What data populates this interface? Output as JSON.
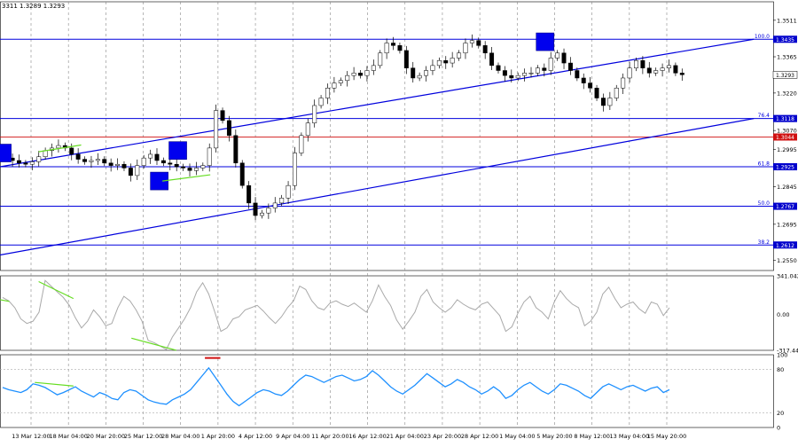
{
  "header": {
    "ohlc_text": "3311 1.3289 1.3293"
  },
  "chart_data": [
    {
      "type": "candlestick",
      "title": "",
      "ylim": [
        1.251,
        1.3585
      ],
      "price_ticks": [
        1.3511,
        1.3365,
        1.322,
        1.307,
        1.2995,
        1.2845,
        1.2695,
        1.255
      ],
      "current_price": "1.3293",
      "fib_levels": [
        {
          "label": "100.0",
          "value": 1.3435,
          "value_text": "1.3435",
          "color": "#0000dd"
        },
        {
          "label": "76.4",
          "value": 1.3118,
          "value_text": "1.3118",
          "color": "#0000dd"
        },
        {
          "label": "61.8",
          "value": 1.2925,
          "value_text": "1.2925",
          "color": "#0000dd"
        },
        {
          "label": "50.0",
          "value": 1.2767,
          "value_text": "1.2767",
          "color": "#0000dd"
        },
        {
          "label": "38.2",
          "value": 1.2612,
          "value_text": "1.2612",
          "color": "#0000dd"
        }
      ],
      "red_level": {
        "value": 1.3044,
        "value_text": "1.3044",
        "color": "#d01010"
      },
      "x_labels": [
        "13 Mar 12:00",
        "18 Mar 04:00",
        "20 Mar 20:00",
        "25 Mar 12:00",
        "28 Mar 04:00",
        "1 Apr 20:00",
        "4 Apr 12:00",
        "9 Apr 04:00",
        "11 Apr 20:00",
        "16 Apr 12:00",
        "21 Apr 04:00",
        "23 Apr 20:00",
        "28 Apr 12:00",
        "1 May 04:00",
        "5 May 20:00",
        "8 May 12:00",
        "13 May 04:00",
        "15 May 20:00"
      ],
      "close_series": [
        1.296,
        1.295,
        1.294,
        1.2935,
        1.2945,
        1.2965,
        1.299,
        1.3,
        1.301,
        1.3,
        1.2975,
        1.2955,
        1.2945,
        1.295,
        1.2955,
        1.294,
        1.293,
        1.2935,
        1.292,
        1.289,
        1.293,
        1.296,
        1.2975,
        1.295,
        1.294,
        1.2935,
        1.2925,
        1.292,
        1.291,
        1.292,
        1.293,
        1.3,
        1.315,
        1.311,
        1.305,
        1.294,
        1.285,
        1.278,
        1.273,
        1.274,
        1.276,
        1.278,
        1.28,
        1.285,
        1.298,
        1.305,
        1.31,
        1.317,
        1.32,
        1.324,
        1.326,
        1.327,
        1.329,
        1.33,
        1.329,
        1.331,
        1.333,
        1.338,
        1.342,
        1.341,
        1.339,
        1.332,
        1.328,
        1.329,
        1.331,
        1.333,
        1.335,
        1.334,
        1.336,
        1.338,
        1.342,
        1.343,
        1.341,
        1.338,
        1.333,
        1.331,
        1.329,
        1.328,
        1.329,
        1.33,
        1.33,
        1.332,
        1.331,
        1.336,
        1.338,
        1.334,
        1.331,
        1.328,
        1.326,
        1.324,
        1.32,
        1.317,
        1.32,
        1.324,
        1.328,
        1.332,
        1.335,
        1.332,
        1.33,
        1.331,
        1.332,
        1.333,
        1.33,
        1.3293
      ],
      "boxes": [
        {
          "t": 0.003,
          "value": 1.298
        },
        {
          "t": 0.23,
          "value": 1.299
        },
        {
          "t": 0.206,
          "value": 1.2868
        },
        {
          "t": 0.705,
          "value": 1.3425
        }
      ],
      "channel_upper": {
        "t1": 0.0,
        "v1": 1.2925,
        "t2": 0.975,
        "v2": 1.3435
      },
      "channel_lower": {
        "t1": 0.0,
        "v1": 1.2572,
        "t2": 0.975,
        "v2": 1.3118
      },
      "divergence_lines": [
        {
          "t1": 0.21,
          "v1": 1.2868,
          "t2": 0.272,
          "v2": 1.2893
        },
        {
          "t1": 0.05,
          "v1": 1.2985,
          "t2": 0.105,
          "v2": 1.3012
        }
      ]
    },
    {
      "type": "line",
      "name": "cci-panel",
      "ticks": [
        "341.0423",
        "0.00",
        "-317.444"
      ],
      "tick_values": [
        341.0423,
        0.0,
        -317.444
      ],
      "ylim": [
        -317.444,
        341.0423
      ],
      "values": [
        150,
        120,
        60,
        -40,
        -80,
        -60,
        20,
        300,
        250,
        200,
        150,
        80,
        -30,
        -120,
        -60,
        40,
        -20,
        -100,
        -80,
        60,
        160,
        120,
        40,
        -60,
        -230,
        -250,
        -280,
        -310,
        -200,
        -120,
        -40,
        60,
        200,
        280,
        180,
        20,
        -150,
        -120,
        -40,
        -20,
        40,
        60,
        80,
        30,
        -30,
        -80,
        -20,
        60,
        120,
        250,
        220,
        120,
        60,
        40,
        100,
        120,
        90,
        70,
        100,
        60,
        20,
        120,
        260,
        160,
        80,
        -50,
        -130,
        -60,
        20,
        160,
        220,
        110,
        60,
        20,
        60,
        130,
        90,
        60,
        40,
        90,
        110,
        50,
        -10,
        -150,
        -110,
        10,
        110,
        160,
        60,
        20,
        -40,
        110,
        210,
        140,
        90,
        60,
        -100,
        -60,
        20,
        180,
        240,
        140,
        60,
        90,
        110,
        50,
        10,
        110,
        90,
        -10,
        60
      ],
      "divergence_lines": [
        {
          "t1": 0.05,
          "v1": 290,
          "t2": 0.095,
          "v2": 140
        },
        {
          "t1": 0.17,
          "v1": -210,
          "t2": 0.228,
          "v2": -317
        },
        {
          "t1": 0.0,
          "v1": 130,
          "t2": 0.012,
          "v2": 115
        }
      ]
    },
    {
      "type": "line",
      "name": "rsi-panel",
      "ticks": [
        "100",
        "80",
        "20",
        "0"
      ],
      "tick_values": [
        100,
        80,
        20,
        0
      ],
      "ylim": [
        0,
        100
      ],
      "values": [
        55,
        52,
        50,
        48,
        52,
        60,
        58,
        55,
        50,
        45,
        48,
        52,
        56,
        50,
        46,
        42,
        48,
        45,
        40,
        38,
        48,
        52,
        50,
        44,
        38,
        35,
        33,
        32,
        38,
        42,
        46,
        52,
        62,
        72,
        82,
        70,
        58,
        46,
        36,
        30,
        36,
        42,
        48,
        52,
        50,
        46,
        44,
        50,
        58,
        66,
        72,
        70,
        66,
        62,
        66,
        70,
        72,
        68,
        64,
        66,
        70,
        78,
        72,
        64,
        56,
        50,
        46,
        52,
        58,
        66,
        74,
        68,
        62,
        56,
        60,
        66,
        62,
        56,
        52,
        46,
        50,
        56,
        50,
        40,
        44,
        52,
        58,
        62,
        56,
        50,
        46,
        52,
        60,
        58,
        54,
        50,
        44,
        40,
        48,
        56,
        60,
        56,
        52,
        56,
        58,
        54,
        50,
        54,
        56,
        48,
        52
      ],
      "marker_red": {
        "t1": 0.265,
        "t2": 0.285,
        "v": 98
      },
      "divergence_lines": [
        {
          "t1": 0.045,
          "v1": 62,
          "t2": 0.095,
          "v2": 57
        }
      ]
    }
  ]
}
